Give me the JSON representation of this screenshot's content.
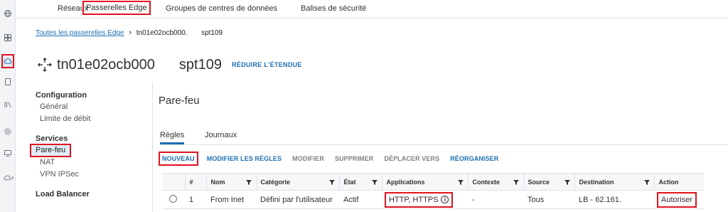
{
  "top_nav": {
    "tabs": [
      {
        "label": "Réseaux"
      },
      {
        "label": "Passerelles Edge"
      },
      {
        "label": "Groupes de centres de données"
      },
      {
        "label": "Balises de sécurité"
      }
    ]
  },
  "breadcrumb": {
    "link": "Toutes les passerelles Edge",
    "separator": "›",
    "current_a": "tn01e02ocb000.",
    "current_b": "spt109"
  },
  "header": {
    "title_a": "tn01e02ocb000",
    "title_b": "spt109",
    "reduce_label": "RÉDUIRE L'ÉTENDUE"
  },
  "menu": {
    "configuration": {
      "heading": "Configuration",
      "items": [
        "Général",
        "Limite de débit"
      ]
    },
    "services": {
      "heading": "Services",
      "items": [
        "Pare-feu",
        "NAT",
        "VPN IPSec"
      ]
    },
    "load_balancer": {
      "heading": "Load Balancer"
    }
  },
  "main": {
    "title": "Pare-feu",
    "tabs": [
      "Règles",
      "Journaux"
    ],
    "actions": {
      "new": "NOUVEAU",
      "edit_rules": "MODIFIER LES RÈGLES",
      "edit": "MODIFIER",
      "delete": "SUPPRIMER",
      "move_to": "DÉPLACER VERS",
      "reorder": "RÉORGANISER"
    }
  },
  "table": {
    "headers": [
      "#",
      "Nom",
      "Catégorie",
      "État",
      "Applications",
      "Contexte",
      "Source",
      "Destination",
      "Action"
    ],
    "rows": [
      {
        "number": "1",
        "name": "From Inet",
        "category": "Défini par l'utilisateur",
        "state": "Actif",
        "applications": "HTTP, HTTPS",
        "context": "-",
        "source": "Tous",
        "destination": "LB - 62.161.",
        "action": "Autoriser"
      }
    ]
  },
  "icons": {
    "rail": [
      "globe-icon",
      "grid-icon",
      "cloud-icon",
      "document-icon",
      "library-icon",
      "gear-icon",
      "monitor-icon",
      "cloud-expand-icon"
    ],
    "header": "edge-gateway-arrows-icon",
    "filter": "filter-icon",
    "info": "info-icon"
  },
  "colors": {
    "accent": "#1b6fb3",
    "highlight_box": "#e0131f",
    "selected_bg": "#e1ecf7"
  }
}
